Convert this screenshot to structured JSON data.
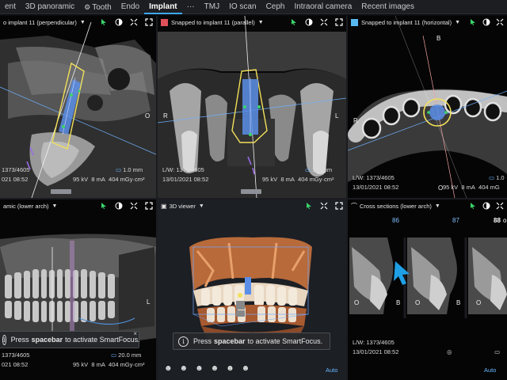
{
  "tabs": [
    {
      "label": "ent",
      "active": false
    },
    {
      "label": "3D panoramic",
      "active": false
    },
    {
      "label": "Tooth",
      "active": false,
      "icon": "gear-icon"
    },
    {
      "label": "Endo",
      "active": false
    },
    {
      "label": "Implant",
      "active": true
    },
    {
      "label": "···",
      "active": false
    },
    {
      "label": "TMJ",
      "active": false
    },
    {
      "label": "IO scan",
      "active": false
    },
    {
      "label": "Ceph",
      "active": false
    },
    {
      "label": "Intraoral camera",
      "active": false
    },
    {
      "label": "Recent images",
      "active": false
    }
  ],
  "colors": {
    "accent": "#3da9f5",
    "implant_outline": "#f2e05a",
    "implant_body": "#5a8ee8",
    "swatch_red": "#e0505a",
    "swatch_blue": "#58b8f0",
    "crosshair_blue": "#6fb0ff",
    "marker_green": "#3bd46a",
    "nerve_purple": "#9a6be8"
  },
  "viewports": {
    "perp": {
      "title": "o implant 11 (perpendicular)",
      "orient_right": "O",
      "lw": "1373/4605",
      "date": "021 08:52",
      "thickness": "1.0 mm",
      "kv": "95 kV",
      "ma": "8 mA",
      "dose": "404 mGy·cm²"
    },
    "parallel": {
      "title": "Snapped to implant 11 (parallel)",
      "orient_left": "R",
      "orient_right": "L",
      "lw": "L/W: 1373/4605",
      "date": "13/01/2021 08:52",
      "thickness": "1.0 mm",
      "kv": "95 kV",
      "ma": "8 mA",
      "dose": "404 mGy·cm²"
    },
    "horizontal": {
      "title": "Snapped to implant 11 (horizontal)",
      "orient_top": "B",
      "orient_left": "R",
      "orient_bottom": "O",
      "lw": "L/W: 1373/4605",
      "date": "13/01/2021 08:52",
      "thickness": "1.0",
      "kv": "95 kV",
      "ma": "8 mA",
      "dose": "404 mG"
    },
    "panoramic": {
      "title": "amic (lower arch)",
      "orient_right": "L",
      "lw": "1373/4605",
      "date": "021 08:52",
      "thickness": "20.0 mm",
      "kv": "95 kV",
      "ma": "8 mA",
      "dose": "404 mGy·cm²"
    },
    "viewer3d": {
      "title": "3D viewer",
      "auto": "Auto"
    },
    "cross": {
      "title": "Cross sections (lower arch)",
      "slice_numbers": [
        "86",
        "87",
        "88"
      ],
      "slice_suffix": "o",
      "orient_o": "O",
      "orient_b": "B",
      "lw": "L/W: 1373/4605",
      "date": "13/01/2021 08:52",
      "auto": "Auto"
    }
  },
  "smartfocus": {
    "prefix": "Press",
    "key": "spacebar",
    "suffix": "to activate SmartFocus.",
    "close": "×"
  }
}
